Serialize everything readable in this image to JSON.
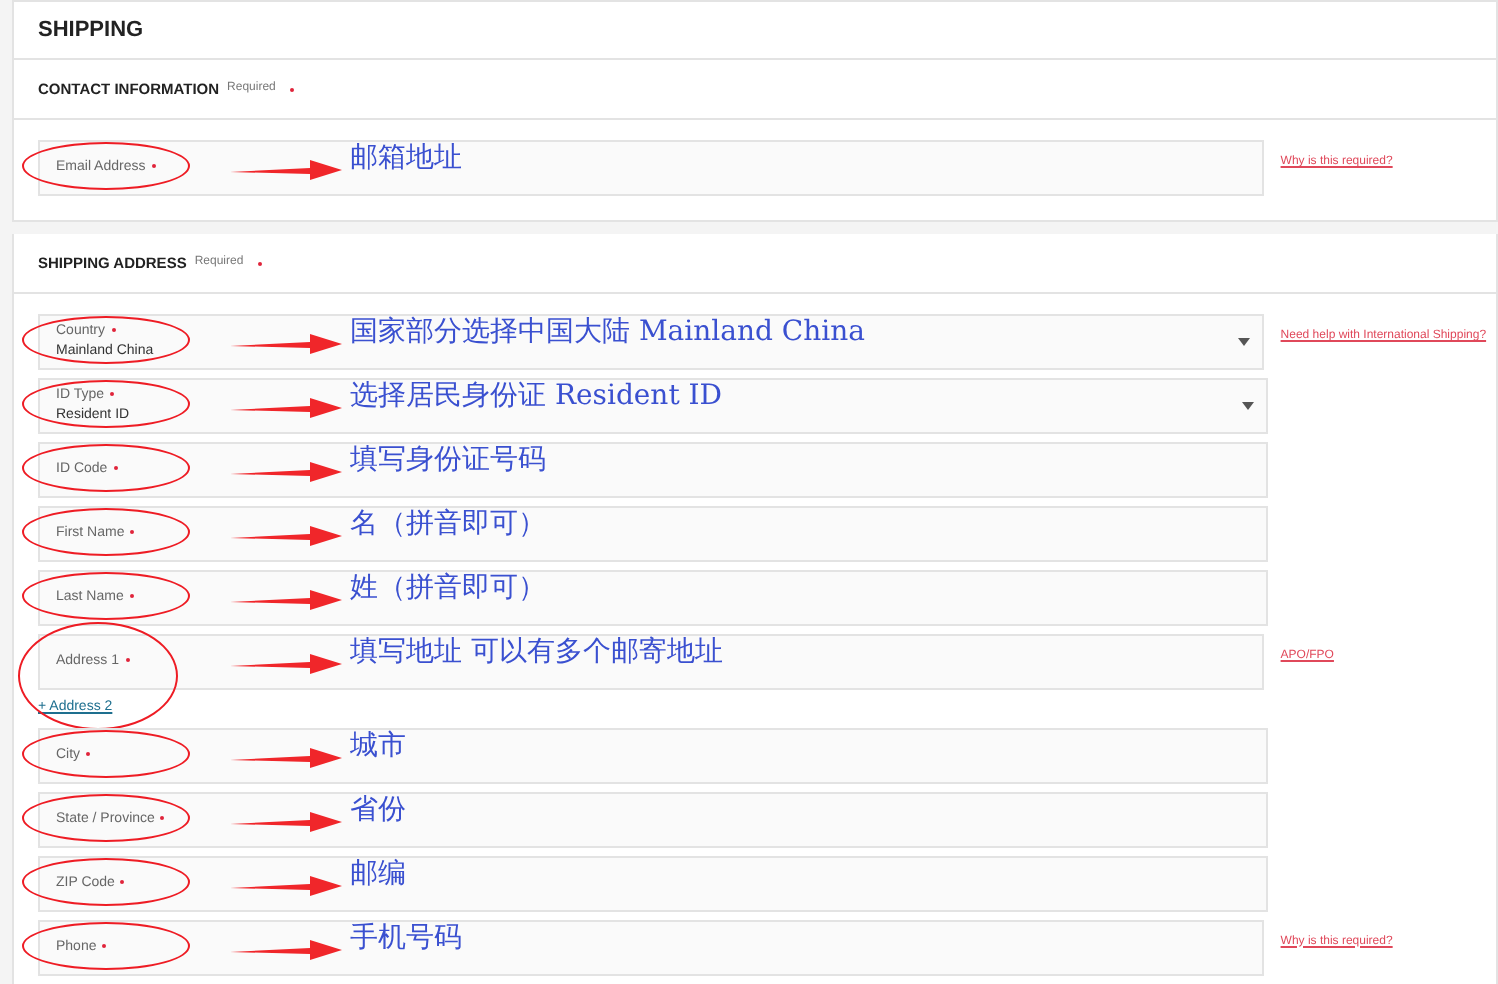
{
  "title": "SHIPPING",
  "sections": [
    {
      "heading": "CONTACT INFORMATION",
      "required_note": "Required",
      "fields": [
        {
          "kind": "text",
          "label": "Email Address",
          "required": true,
          "help_link": "Why is this required?",
          "note": "邮箱地址"
        }
      ]
    },
    {
      "heading": "SHIPPING ADDRESS",
      "required_note": "Required",
      "fields": [
        {
          "kind": "select",
          "label": "Country",
          "required": true,
          "value": "Mainland China",
          "help_link": "Need help with International Shipping?",
          "note": "国家部分选择中国大陆 Mainland China"
        },
        {
          "kind": "select",
          "label": "ID Type",
          "required": true,
          "value": "Resident ID",
          "note": "选择居民身份证 Resident ID"
        },
        {
          "kind": "text",
          "label": "ID Code",
          "required": true,
          "note": "填写身份证号码"
        },
        {
          "kind": "text",
          "label": "First Name",
          "required": true,
          "note": "名（拼音即可）"
        },
        {
          "kind": "text",
          "label": "Last Name",
          "required": true,
          "note": "姓（拼音即可）"
        },
        {
          "kind": "text",
          "label": "Address 1",
          "required": true,
          "help_link": "APO/FPO",
          "extra_link": "+ Address 2",
          "note": "填写地址  可以有多个邮寄地址"
        },
        {
          "kind": "text",
          "label": "City",
          "required": true,
          "note": "城市"
        },
        {
          "kind": "text",
          "label": "State / Province",
          "required": true,
          "note": "省份"
        },
        {
          "kind": "text",
          "label": "ZIP Code",
          "required": true,
          "note": "邮编"
        },
        {
          "kind": "text",
          "label": "Phone",
          "required": true,
          "help_link": "Why is this required?",
          "note": "手机号码"
        }
      ]
    }
  ]
}
